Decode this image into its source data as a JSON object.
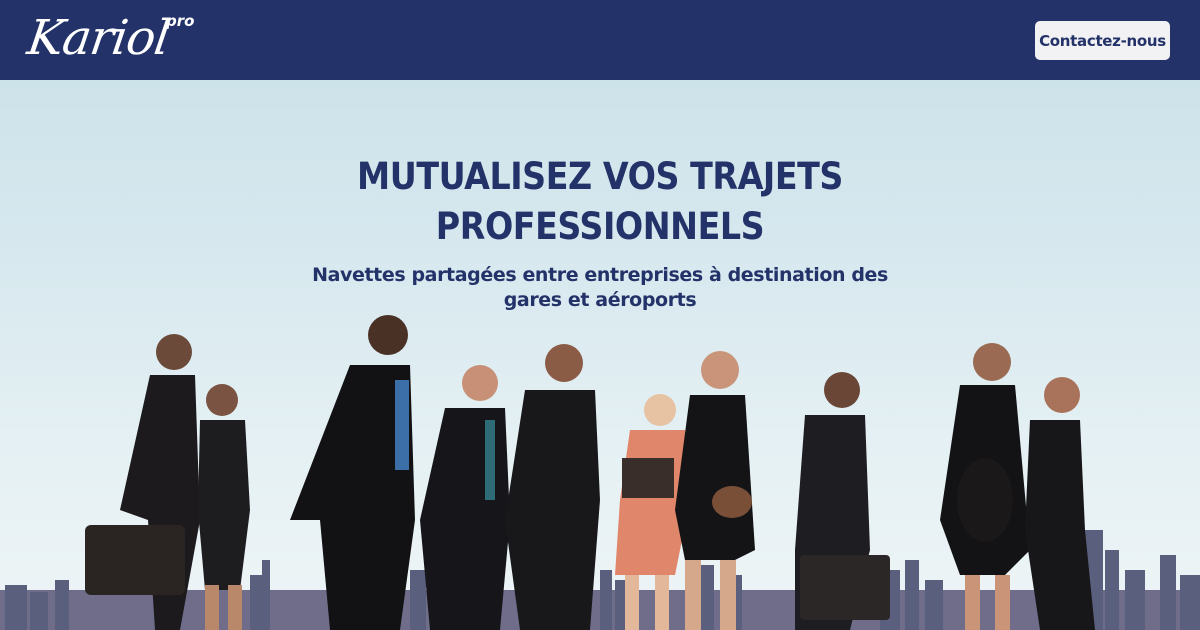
{
  "header": {
    "logo": {
      "wordmark": "Kariol",
      "superscript": "pro"
    },
    "contact_button": "Contactez-nous"
  },
  "hero": {
    "title": "MUTUALISEZ VOS TRAJETS PROFESSIONNELS",
    "subtitle": "Navettes partagées entre entreprises à destination des gares et aéroports",
    "image": "Business people walking in a line in front of a city skyline"
  },
  "colors": {
    "brand_navy": "#233268",
    "button_bg": "#f2f2f4",
    "sky": "#d8e9ef"
  }
}
